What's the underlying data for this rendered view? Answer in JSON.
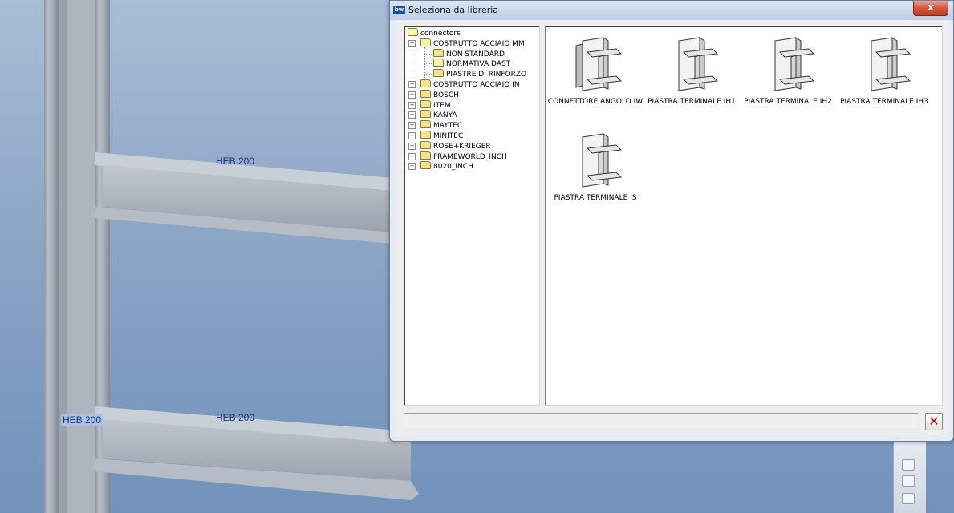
{
  "window": {
    "title": "Seleziona da libreria",
    "app_badge": "bw"
  },
  "cad_labels": [
    "HEB 200",
    "HEB 200",
    "HEB 200"
  ],
  "tree": [
    {
      "label": "connectors",
      "open": true
    },
    {
      "label": "COSTRUTTO ACCIAIO MM",
      "open": true,
      "expander": "−"
    },
    {
      "label": "NON STANDARD",
      "open": false
    },
    {
      "label": "NORMATIVA DAST",
      "open": true
    },
    {
      "label": "PIASTRE DI RINFORZO",
      "open": false
    },
    {
      "label": "COSTRUTTO ACCIAIO IN",
      "open": false,
      "expander": "+"
    },
    {
      "label": "BOSCH",
      "open": false,
      "expander": "+"
    },
    {
      "label": "ITEM",
      "open": false,
      "expander": "+"
    },
    {
      "label": "KANYA",
      "open": false,
      "expander": "+"
    },
    {
      "label": "MAYTEC",
      "open": false,
      "expander": "+"
    },
    {
      "label": "MINITEC",
      "open": false,
      "expander": "+"
    },
    {
      "label": "ROSE+KRIEGER",
      "open": false,
      "expander": "+"
    },
    {
      "label": "FRAMEWORLD_INCH",
      "open": false,
      "expander": "+"
    },
    {
      "label": "8020_INCH",
      "open": false,
      "expander": "+"
    }
  ],
  "items": [
    {
      "label": "CONNETTORE ANGOLO IW"
    },
    {
      "label": "PIASTRA TERMINALE IH1"
    },
    {
      "label": "PIASTRA TERMINALE IH2"
    },
    {
      "label": "PIASTRA TERMINALE IH3"
    },
    {
      "label": "PIASTRA TERMINALE IS"
    }
  ],
  "status": {
    "text": ""
  },
  "buttons": {
    "close_label": "x",
    "cancel_label": "✕"
  },
  "icons": {
    "close": "close-icon",
    "cancel": "cancel-icon",
    "folder": "folder-icon"
  }
}
